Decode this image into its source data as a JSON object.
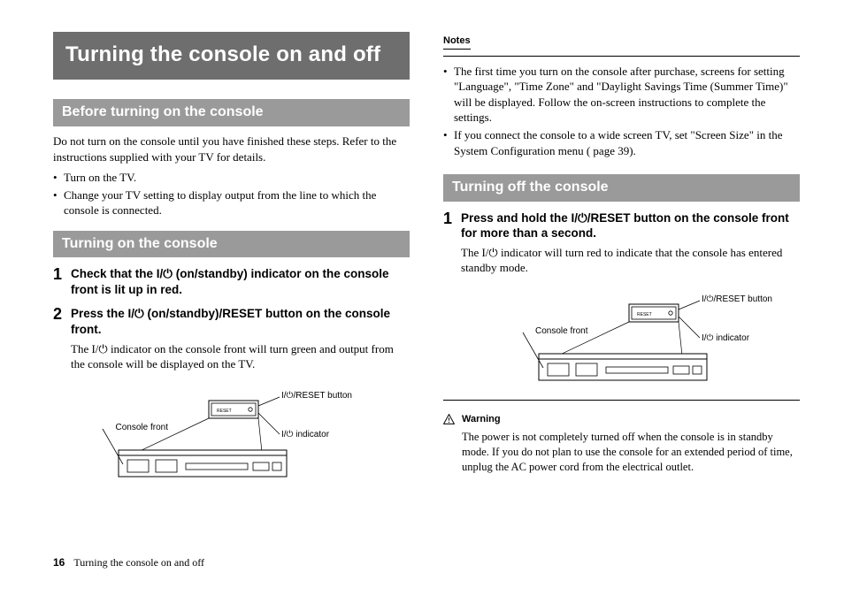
{
  "page": {
    "number": "16",
    "footer": "Turning the console on and off"
  },
  "left": {
    "title": "Turning the console on and off",
    "sec1": {
      "heading": "Before turning on the console",
      "intro": "Do not turn on the console until you have finished these steps. Refer to the instructions supplied with your TV for details.",
      "b1": "Turn on the TV.",
      "b2": "Change your TV setting to display output from the line to which the console is connected."
    },
    "sec2": {
      "heading": "Turning on the console",
      "s1": "Check that the I/⏻ (on/standby) indicator on the console front is lit up in red.",
      "s2": "Press the I/⏻ (on/standby)/RESET button on the console front.",
      "s2sub": "The I/⏻ indicator on the console front will turn green and output from the console will be displayed on the TV."
    },
    "fig": {
      "reset": "I/⏻/RESET button",
      "front": "Console front",
      "ind": "I/⏻ indicator"
    }
  },
  "right": {
    "notes": {
      "label": "Notes",
      "n1": "The first time you turn on the console after purchase, screens for setting \"Language\", \"Time Zone\" and \"Daylight Savings Time (Summer Time)\" will be displayed. Follow the on-screen instructions to complete the settings.",
      "n2": "If you connect the console to a wide screen TV, set \"Screen Size\" in the System Configuration menu (  page 39)."
    },
    "sec3": {
      "heading": "Turning off the console",
      "s1": "Press and hold the I/⏻/RESET button on the console front for more than a second.",
      "s1sub": "The I/⏻ indicator will turn red to indicate that the console has entered standby mode."
    },
    "fig": {
      "reset": "I/⏻/RESET button",
      "front": "Console front",
      "ind": "I/⏻ indicator"
    },
    "warn": {
      "title": "Warning",
      "body": "The power is not completely turned off when the console is in standby mode. If you do not plan to use the console for an extended period of time, unplug the AC power cord from the electrical outlet."
    }
  }
}
